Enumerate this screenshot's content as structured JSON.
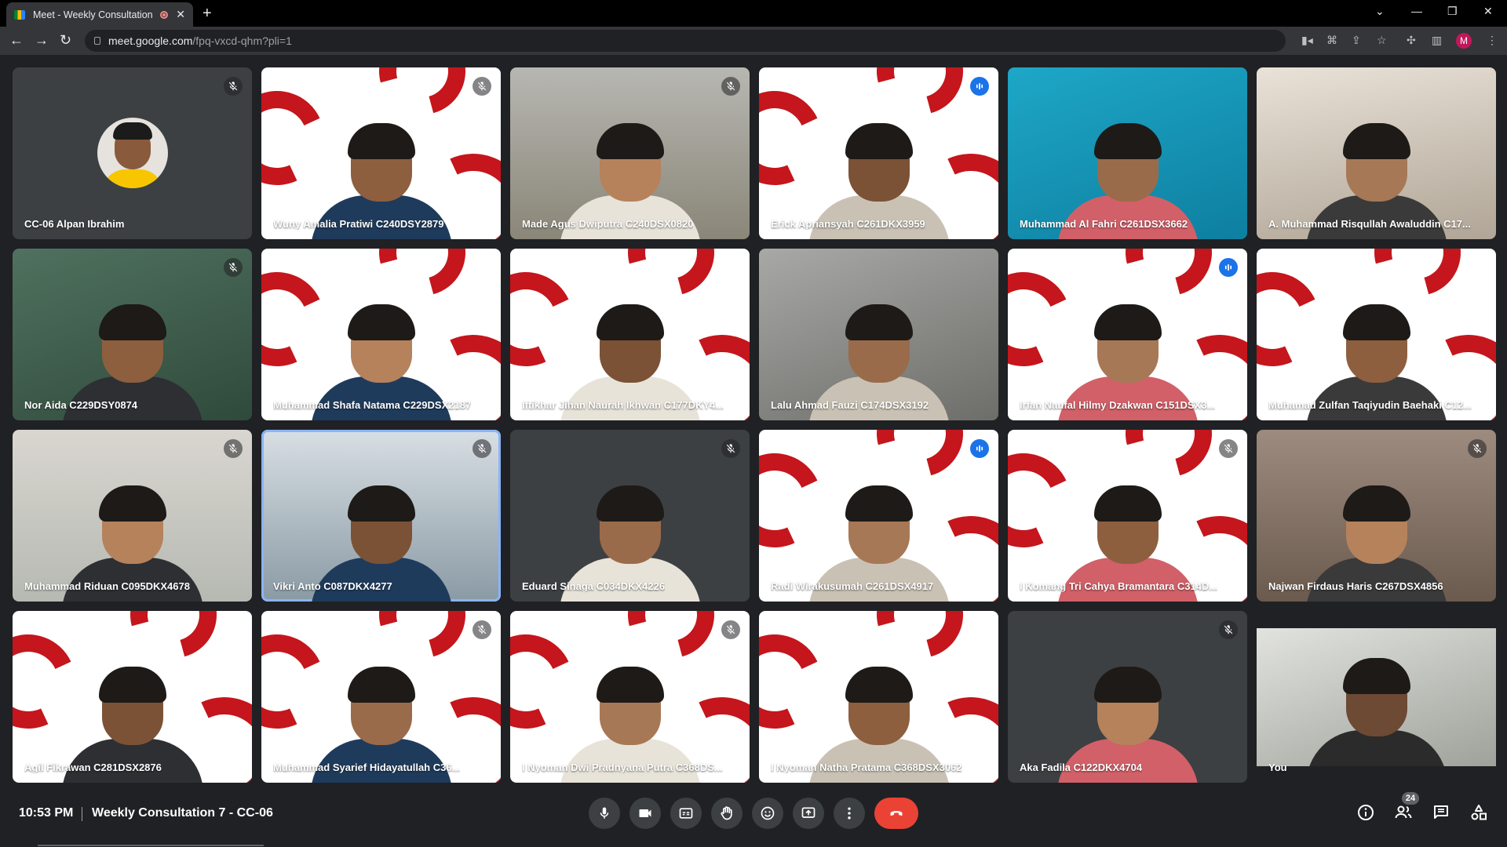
{
  "browser": {
    "tab_title": "Meet - Weekly Consultation",
    "url_host": "meet.google.com",
    "url_path": "/fpq-vxcd-qhm?pli=1",
    "profile_initial": "M"
  },
  "participants": [
    {
      "name": "CC-06 Alpan Ibrahim",
      "muted": true,
      "speaking": false,
      "bg": "dark",
      "avatar": true
    },
    {
      "name": "Wuny Amalia Pratiwi C240DSY2879",
      "muted": true,
      "speaking": false,
      "bg": "brand"
    },
    {
      "name": "Made Agus Dwiputra C240DSX0820",
      "muted": true,
      "speaking": false,
      "bg": "room"
    },
    {
      "name": "Erick Apriansyah C261DKX3959",
      "muted": false,
      "speaking": true,
      "bg": "brand"
    },
    {
      "name": "Muhammad Al Fahri C261DSX3662",
      "muted": false,
      "speaking": false,
      "bg": "teal"
    },
    {
      "name": "A. Muhammad Risqullah Awaluddin C17...",
      "muted": false,
      "speaking": false,
      "bg": "cream"
    },
    {
      "name": "Nor Aida C229DSY0874",
      "muted": true,
      "speaking": false,
      "bg": "green"
    },
    {
      "name": "Muhammad Shafa Natama C229DSX2187",
      "muted": false,
      "speaking": false,
      "bg": "brand"
    },
    {
      "name": "Iftikhar Jihan Naurah Ikhwan C177DKY4...",
      "muted": false,
      "speaking": false,
      "bg": "brand"
    },
    {
      "name": "Lalu Ahmad Fauzi C174DSX3192",
      "muted": false,
      "speaking": false,
      "bg": "grey"
    },
    {
      "name": "Irfan Naufal Hilmy Dzakwan C151DSX3...",
      "muted": false,
      "speaking": true,
      "bg": "brand"
    },
    {
      "name": "Muhamad Zulfan Taqiyudin Baehaki C12...",
      "muted": false,
      "speaking": false,
      "bg": "brand"
    },
    {
      "name": "Muhammad Riduan C095DKX4678",
      "muted": true,
      "speaking": false,
      "bg": "office"
    },
    {
      "name": "Vikri Anto C087DKX4277",
      "muted": true,
      "speaking": false,
      "bg": "photo",
      "active": true
    },
    {
      "name": "Eduard Sinaga C034DKX4226",
      "muted": true,
      "speaking": false,
      "bg": "dark"
    },
    {
      "name": "Radi Wirakusumah C261DSX4917",
      "muted": false,
      "speaking": true,
      "bg": "brand"
    },
    {
      "name": "I Komang Tri Cahya Bramantara C314D...",
      "muted": true,
      "speaking": false,
      "bg": "brand"
    },
    {
      "name": "Najwan Firdaus Haris C267DSX4856",
      "muted": true,
      "speaking": false,
      "bg": "wall"
    },
    {
      "name": "Agil Fikrawan C281DSX2876",
      "muted": false,
      "speaking": false,
      "bg": "brand"
    },
    {
      "name": "Muhammad Syarief Hidayatullah C36...",
      "muted": true,
      "speaking": false,
      "bg": "brand"
    },
    {
      "name": "I Nyoman Dwi Pradnyana Putra C368DS...",
      "muted": true,
      "speaking": false,
      "bg": "brand"
    },
    {
      "name": "I Nyoman Natha Pratama C368DSX3062",
      "muted": false,
      "speaking": false,
      "bg": "brand"
    },
    {
      "name": "Aka Fadila C122DKX4704",
      "muted": true,
      "speaking": false,
      "bg": "dark"
    },
    {
      "name": "You",
      "muted": false,
      "speaking": false,
      "bg": "you"
    }
  ],
  "bottom_bar": {
    "time": "10:53 PM",
    "meeting_title": "Weekly Consultation 7 - CC-06",
    "participant_count": "24"
  },
  "colors": {
    "brand_red": "#c4161c",
    "end_call": "#ea4335",
    "speaking_blue": "#1a73e8",
    "active_outline": "#8ab4f8"
  }
}
